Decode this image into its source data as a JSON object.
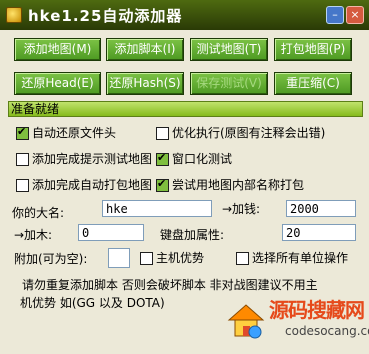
{
  "window": {
    "title": "hke1.25自动添加器"
  },
  "buttons": {
    "add_map": "添加地图(M)",
    "add_script": "添加脚本(I)",
    "test_map": "测试地图(T)",
    "pack_map": "打包地图(P)",
    "restore_head": "还原Head(E)",
    "restore_hash": "还原Hash(S)",
    "disabled_btn": "保存测试(V)",
    "recompress": "重压缩(C)"
  },
  "status": {
    "text": "准备就绪"
  },
  "options": [
    {
      "label": "自动还原文件头",
      "checked": true
    },
    {
      "label": "优化执行(原图有注释会出错)",
      "checked": false
    },
    {
      "label": "添加完成提示测试地图",
      "checked": false
    },
    {
      "label": "窗口化测试",
      "checked": true
    },
    {
      "label": "添加完成自动打包地图",
      "checked": false
    },
    {
      "label": "尝试用地图内部名称打包",
      "checked": true
    }
  ],
  "form": {
    "name_label": "你的大名:",
    "name_value": "hke",
    "gold_label": "→加钱:",
    "gold_value": "2000",
    "wood_label": "→加木:",
    "wood_value": "0",
    "keyboard_label": "键盘加属性:",
    "keyboard_value": "20",
    "attach_label": "附加(可为空):",
    "attach_value": "",
    "host_label": "主机优势",
    "host_checked": false,
    "select_all_label": "选择所有单位操作",
    "select_all_checked": false
  },
  "footer": {
    "warning_line1": "请勿重复添加脚本 否则会破坏脚本 非对战图建议不用主",
    "warning_line2": "机优势 如(GG 以及 DOTA)"
  },
  "watermark": {
    "text": "源码搜藏网",
    "url": "codesocang.com"
  },
  "colors": {
    "title_bg": "#3d5a0b",
    "button_bg": "#5fae2f",
    "status_bg": "#9fce3a",
    "window_bg": "#ece9d8"
  }
}
